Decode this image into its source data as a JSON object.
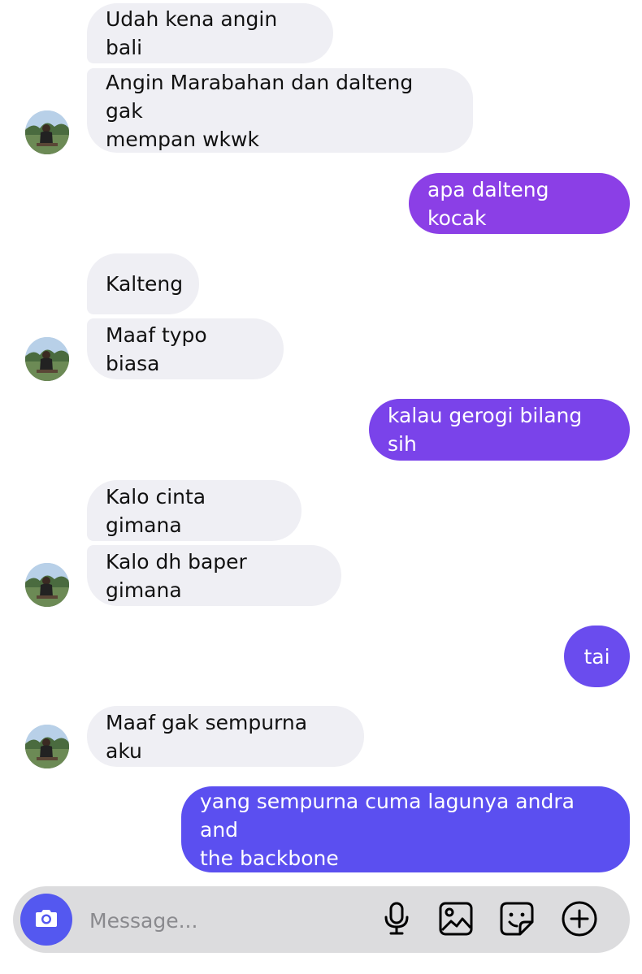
{
  "messages": [
    {
      "side": "received",
      "text": "Udah kena angin bali"
    },
    {
      "side": "received",
      "text": "Angin Marabahan dan dalteng gak\nmempan wkwk"
    },
    {
      "side": "sent",
      "text": "apa dalteng kocak",
      "color": "#8b3fe6"
    },
    {
      "side": "received",
      "text": "Kalteng"
    },
    {
      "side": "received",
      "text": "Maaf typo biasa"
    },
    {
      "side": "sent",
      "text": "kalau gerogi bilang sih",
      "color": "#7a43ea"
    },
    {
      "side": "received",
      "text": "Kalo cinta gimana"
    },
    {
      "side": "received",
      "text": "Kalo dh baper gimana"
    },
    {
      "side": "sent",
      "text": "tai",
      "color": "#6a4cee"
    },
    {
      "side": "received",
      "text": "Maaf gak sempurna aku"
    },
    {
      "side": "sent",
      "text": "yang sempurna cuma lagunya andra and\nthe backbone",
      "color": "#5b4ff0"
    }
  ],
  "composer": {
    "placeholder": "Message...",
    "camera_icon": "camera-icon",
    "tools": [
      "microphone-icon",
      "image-icon",
      "sticker-icon",
      "plus-circle-icon"
    ]
  },
  "colors": {
    "received_bubble": "#efeff4",
    "camera_button": "#5458f0",
    "composer_bg": "#dcdcde"
  }
}
